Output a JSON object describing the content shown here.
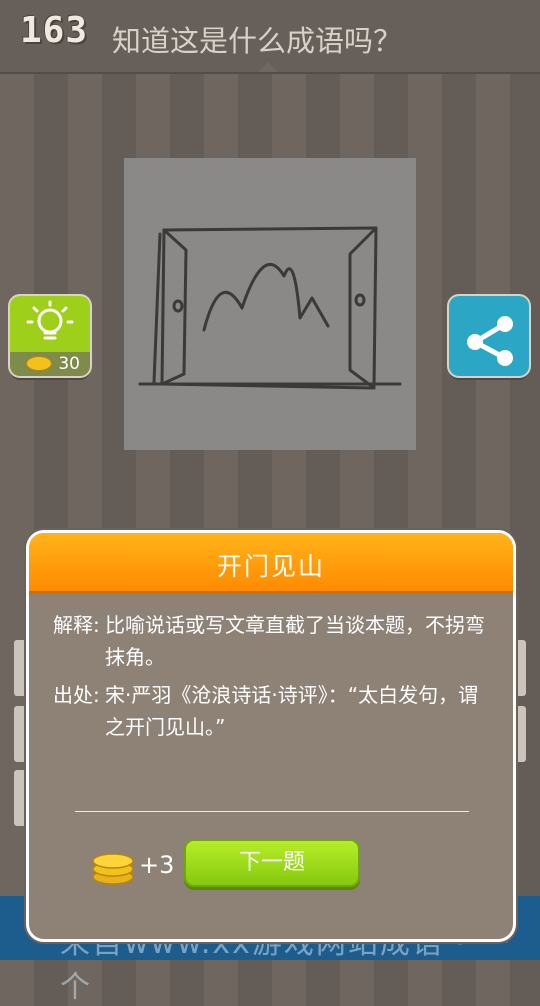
{
  "header": {
    "level": "163",
    "question": "知道这是什么成语吗？"
  },
  "hint": {
    "cost": "30",
    "icon": "lightbulb-icon"
  },
  "share": {
    "icon": "share-icon"
  },
  "bottom_banner": {
    "text": "来自www.xx游戏网站成语 · 一个"
  },
  "modal": {
    "title": "开门见山",
    "explain_label": "解释:",
    "explain_text": "比喻说话或写文章直截了当谈本题，不拐弯抹角。",
    "source_label": "出处:",
    "source_text": "宋·严羽《沧浪诗话·诗评》：“太白发句，谓之开门见山。”",
    "reward": "+3",
    "next_label": "下一题"
  },
  "colors": {
    "header_orange": "#ff9a0a",
    "hint_green": "#9ecf1a",
    "share_blue": "#2ba7c5",
    "next_green": "#9edb1b"
  }
}
